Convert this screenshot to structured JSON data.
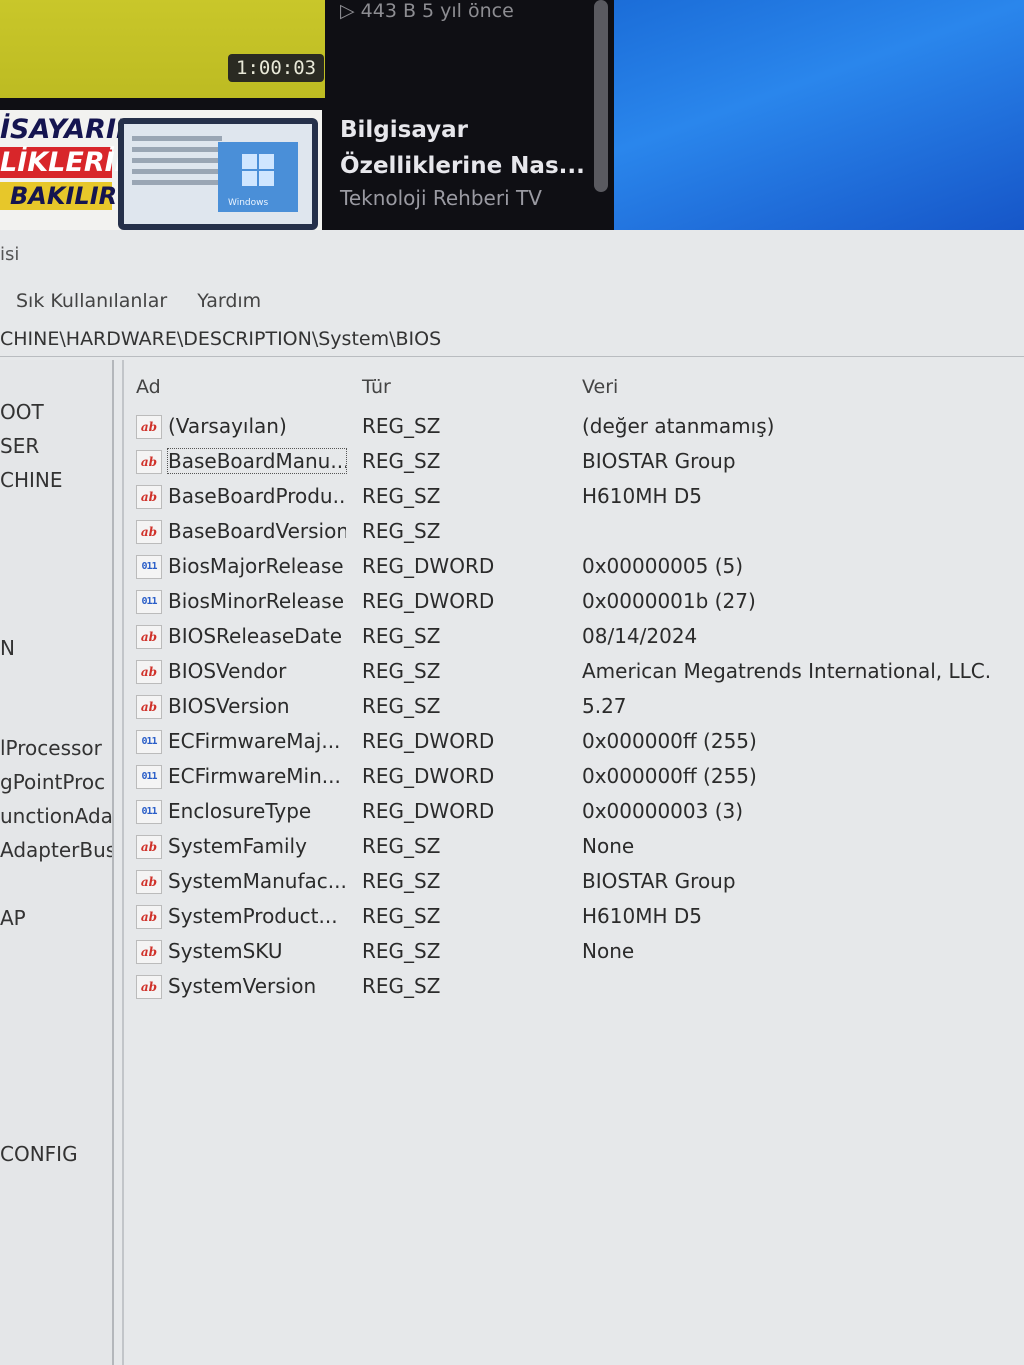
{
  "video": {
    "duration": "1:00:03",
    "views": "▷ 443 B  5 yıl önce",
    "thumb_line1": "İSAYARIN",
    "thumb_line2": "LİKLERİNE",
    "thumb_line3": "BAKILIR?",
    "thumb_windows_label": "Windows",
    "title_line1": "Bilgisayar",
    "title_line2": "Özelliklerine Nas...",
    "channel": "Teknoloji Rehberi TV"
  },
  "window": {
    "title_fragment": "isi",
    "menu": [
      "Sık Kullanılanlar",
      "Yardım"
    ],
    "address": "CHINE\\HARDWARE\\DESCRIPTION\\System\\BIOS"
  },
  "tree": [
    "OOT",
    "SER",
    "CHINE",
    "N",
    "lProcessor",
    "gPointProc",
    "unctionAda",
    "AdapterBus",
    "AP",
    "CONFIG"
  ],
  "columns": {
    "name": "Ad",
    "type": "Tür",
    "data": "Veri"
  },
  "rows": [
    {
      "icon": "ab",
      "name": "(Varsayılan)",
      "type": "REG_SZ",
      "data": "(değer atanmamış)"
    },
    {
      "icon": "ab",
      "name": "BaseBoardManu...",
      "type": "REG_SZ",
      "data": "BIOSTAR Group"
    },
    {
      "icon": "ab",
      "name": "BaseBoardProdu...",
      "type": "REG_SZ",
      "data": "H610MH D5"
    },
    {
      "icon": "ab",
      "name": "BaseBoardVersion",
      "type": "REG_SZ",
      "data": ""
    },
    {
      "icon": "011",
      "name": "BiosMajorRelease",
      "type": "REG_DWORD",
      "data": "0x00000005 (5)"
    },
    {
      "icon": "011",
      "name": "BiosMinorRelease",
      "type": "REG_DWORD",
      "data": "0x0000001b (27)"
    },
    {
      "icon": "ab",
      "name": "BIOSReleaseDate",
      "type": "REG_SZ",
      "data": "08/14/2024"
    },
    {
      "icon": "ab",
      "name": "BIOSVendor",
      "type": "REG_SZ",
      "data": "American Megatrends International, LLC."
    },
    {
      "icon": "ab",
      "name": "BIOSVersion",
      "type": "REG_SZ",
      "data": "5.27"
    },
    {
      "icon": "011",
      "name": "ECFirmwareMaj...",
      "type": "REG_DWORD",
      "data": "0x000000ff (255)"
    },
    {
      "icon": "011",
      "name": "ECFirmwareMin...",
      "type": "REG_DWORD",
      "data": "0x000000ff (255)"
    },
    {
      "icon": "011",
      "name": "EnclosureType",
      "type": "REG_DWORD",
      "data": "0x00000003 (3)"
    },
    {
      "icon": "ab",
      "name": "SystemFamily",
      "type": "REG_SZ",
      "data": "None"
    },
    {
      "icon": "ab",
      "name": "SystemManufac...",
      "type": "REG_SZ",
      "data": "BIOSTAR Group"
    },
    {
      "icon": "ab",
      "name": "SystemProduct...",
      "type": "REG_SZ",
      "data": "H610MH D5"
    },
    {
      "icon": "ab",
      "name": "SystemSKU",
      "type": "REG_SZ",
      "data": "None"
    },
    {
      "icon": "ab",
      "name": "SystemVersion",
      "type": "REG_SZ",
      "data": ""
    }
  ]
}
